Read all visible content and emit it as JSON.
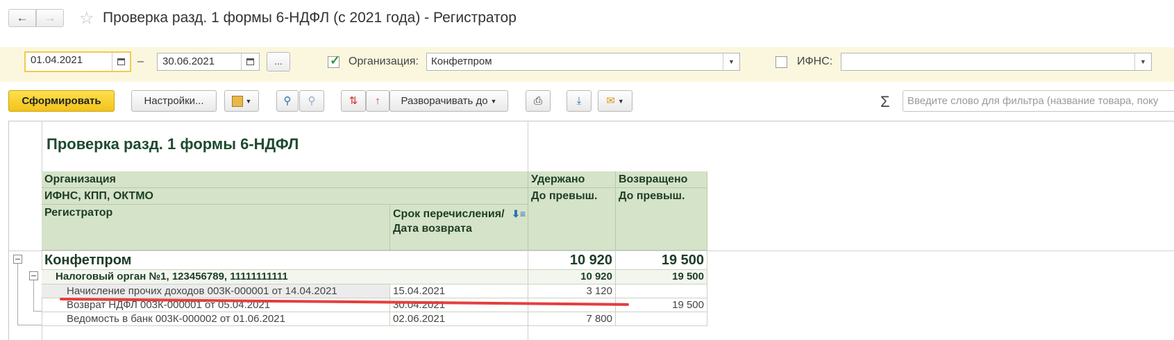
{
  "window": {
    "title": "Проверка разд. 1 формы 6-НДФЛ (с 2021 года) - Регистратор",
    "back_icon": "←",
    "forward_icon": "→",
    "star_icon": "☆"
  },
  "filters": {
    "date_from": "01.04.2021",
    "date_separator": "–",
    "date_to": "30.06.2021",
    "dots_label": "...",
    "org_checked": "✓",
    "org_label": "Организация:",
    "org_value": "Конфетпром",
    "ifns_label": "ИФНС:",
    "ifns_value": ""
  },
  "toolbar": {
    "generate_label": "Сформировать",
    "settings_label": "Настройки...",
    "expand_label": "Разворачивать до",
    "sigma": "Σ",
    "search_placeholder": "Введите слово для фильтра (название товара, поку"
  },
  "report": {
    "title": "Проверка разд. 1 формы 6-НДФЛ",
    "headers": {
      "org": "Организация",
      "ifns": "ИФНС, КПП, ОКТМО",
      "registrar": "Регистратор",
      "deadline": "Срок перечисления/Дата возврата",
      "withheld": "Удержано",
      "withheld_sub": "До превыш.",
      "returned": "Возвращено",
      "returned_sub": "До превыш."
    },
    "group1": {
      "name": "Конфетпром",
      "withheld": "10 920",
      "returned": "19 500"
    },
    "group2": {
      "name": "Налоговый орган №1, 123456789, 11111111111",
      "withheld": "10 920",
      "returned": "19 500"
    },
    "rows": [
      {
        "registrar": "Начисление прочих доходов 003К-000001 от 14.04.2021",
        "date": "15.04.2021",
        "withheld": "3 120",
        "returned": ""
      },
      {
        "registrar": "Возврат НДФЛ 003К-000001 от 05.04.2021",
        "date": "30.04.2021",
        "withheld": "",
        "returned": "19 500"
      },
      {
        "registrar": "Ведомость в банк 003К-000002 от 01.06.2021",
        "date": "02.06.2021",
        "withheld": "7 800",
        "returned": ""
      }
    ]
  },
  "colors": {
    "accent_yellow": "#f3c21a",
    "header_green": "#d5e3c8",
    "title_green": "#1d4a2e",
    "annotation_red": "#e53e3e"
  }
}
